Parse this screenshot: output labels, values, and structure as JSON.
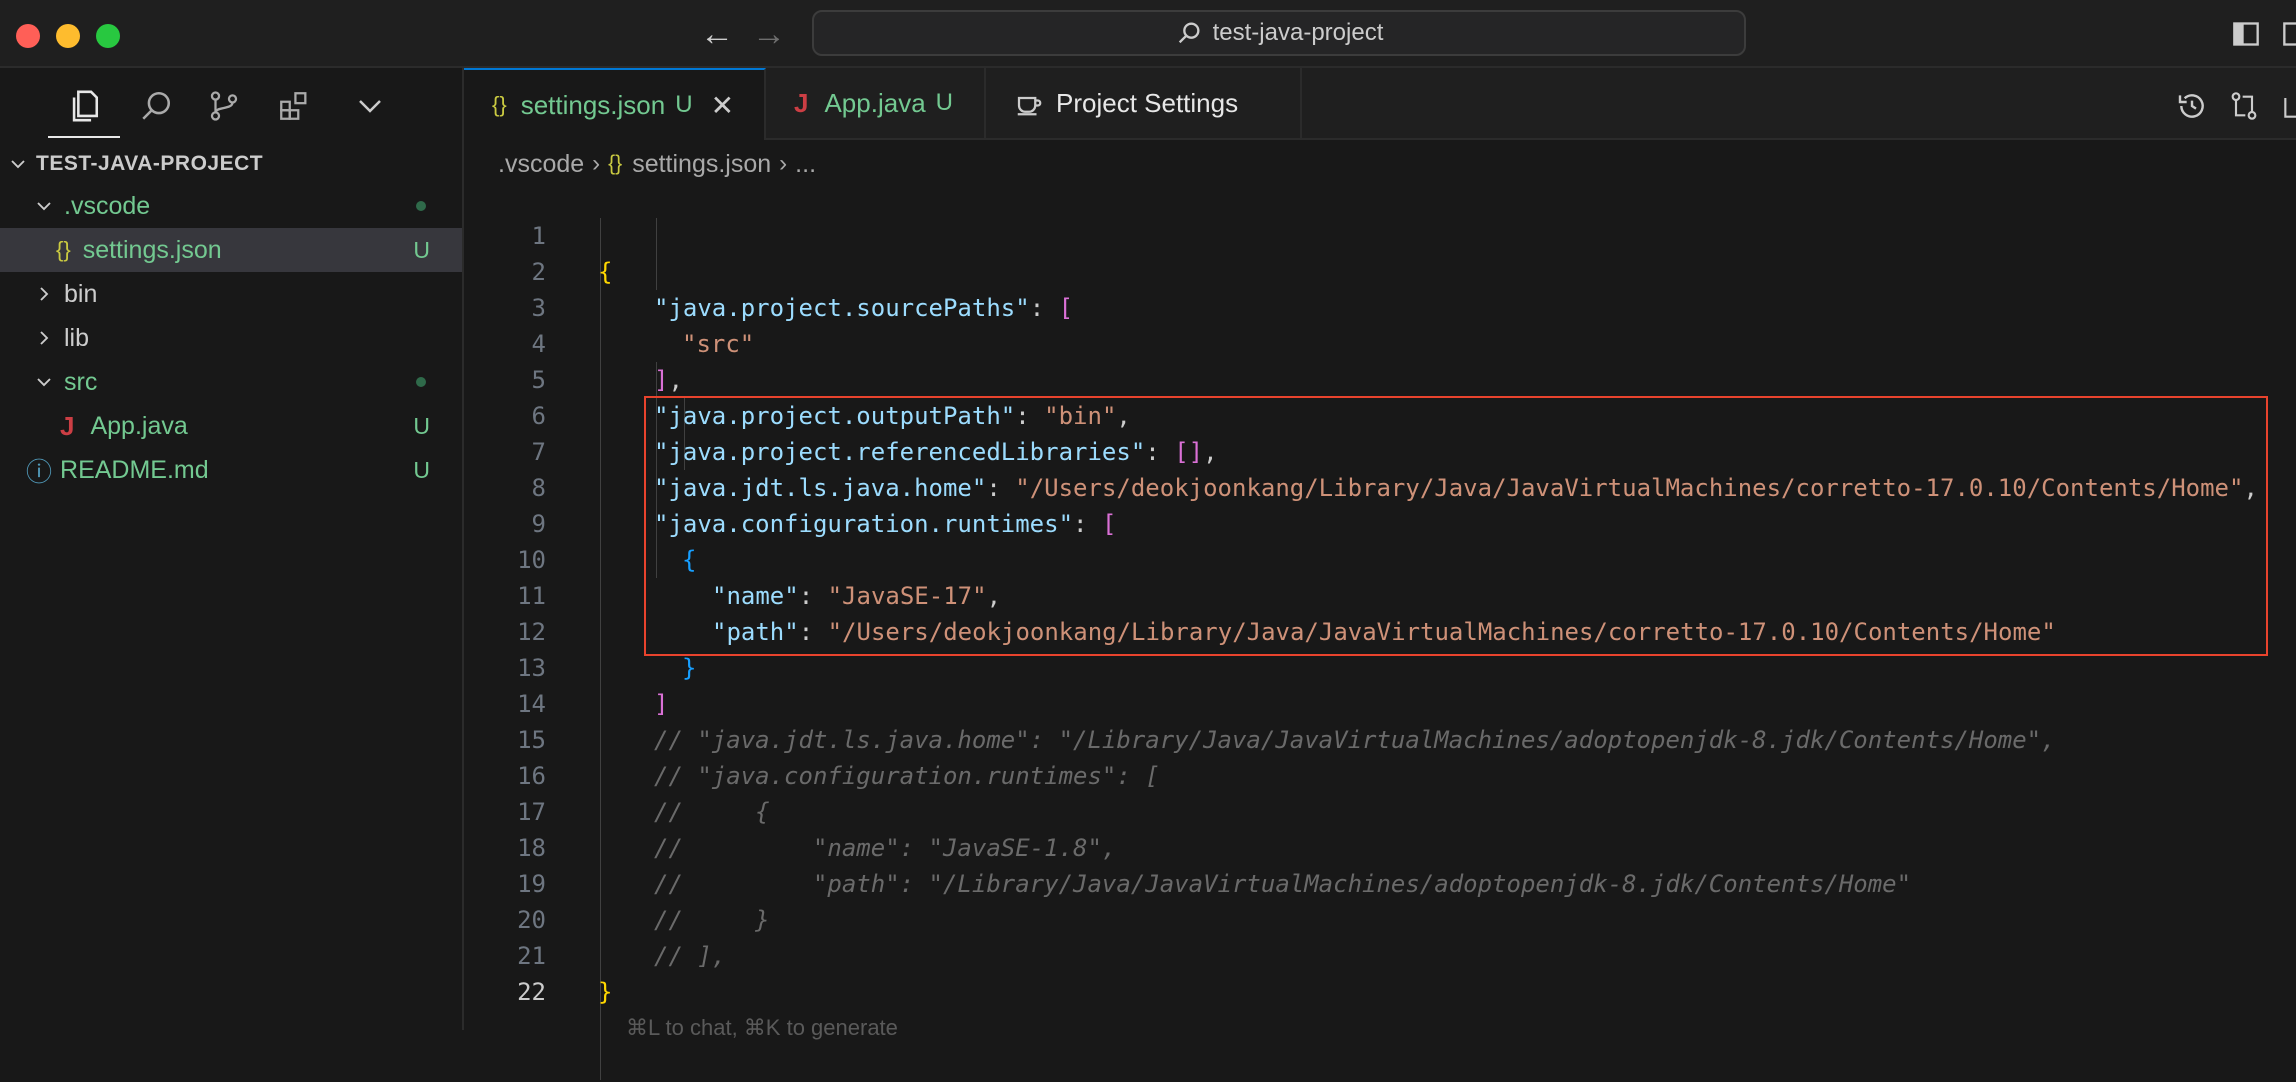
{
  "window": {
    "search_text": "test-java-project"
  },
  "sidebar": {
    "project_title": "TEST-JAVA-PROJECT",
    "items": [
      {
        "label": ".vscode",
        "badge": "",
        "dot": true
      },
      {
        "label": "settings.json",
        "badge": "U"
      },
      {
        "label": "bin",
        "badge": ""
      },
      {
        "label": "lib",
        "badge": ""
      },
      {
        "label": "src",
        "badge": "",
        "dot": true
      },
      {
        "label": "App.java",
        "badge": "U"
      },
      {
        "label": "README.md",
        "badge": "U"
      }
    ],
    "file_icon_json": "{}",
    "file_icon_java": "J",
    "file_icon_info": "ⓘ"
  },
  "tabs": [
    {
      "label": "settings.json",
      "status": "U",
      "icon": "{}"
    },
    {
      "label": "App.java",
      "status": "U",
      "icon": "J"
    },
    {
      "label": "Project Settings",
      "status": ""
    }
  ],
  "breadcrumb": {
    "folder": ".vscode",
    "file": "settings.json",
    "more": "..."
  },
  "editor": {
    "line_numbers": [
      "1",
      "2",
      "3",
      "4",
      "5",
      "6",
      "7",
      "8",
      "9",
      "10",
      "11",
      "12",
      "13",
      "14",
      "15",
      "16",
      "17",
      "18",
      "19",
      "20",
      "21",
      "22"
    ],
    "hint": "⌘L to chat, ⌘K to generate",
    "tokens": {
      "l2_key": "\"java.project.sourcePaths\"",
      "l3_val": "\"src\"",
      "l5_key": "\"java.project.outputPath\"",
      "l5_val": "\"bin\"",
      "l6_key": "\"java.project.referencedLibraries\"",
      "l7_key": "\"java.jdt.ls.java.home\"",
      "l7_val": "\"/Users/deokjoonkang/Library/Java/JavaVirtualMachines/corretto-17.0.10/Contents/Home\"",
      "l8_key": "\"java.configuration.runtimes\"",
      "l10_key": "\"name\"",
      "l10_val": "\"JavaSE-17\"",
      "l11_key": "\"path\"",
      "l11_val": "\"/Users/deokjoonkang/Library/Java/JavaVirtualMachines/corretto-17.0.10/Contents/Home\"",
      "l14": "// \"java.jdt.ls.java.home\": \"/Library/Java/JavaVirtualMachines/adoptopenjdk-8.jdk/Contents/Home\",",
      "l15": "// \"java.configuration.runtimes\": [",
      "l16": "//     {",
      "l17": "//         \"name\": \"JavaSE-1.8\",",
      "l18": "//         \"path\": \"/Library/Java/JavaVirtualMachines/adoptopenjdk-8.jdk/Contents/Home\"",
      "l19": "//     }",
      "l20": "// ],"
    }
  },
  "colors": {
    "highlight_border": "#e8432d",
    "untracked_green": "#73c991",
    "json_icon_yellow": "#cbcb41",
    "java_icon_red": "#cc3e44"
  }
}
